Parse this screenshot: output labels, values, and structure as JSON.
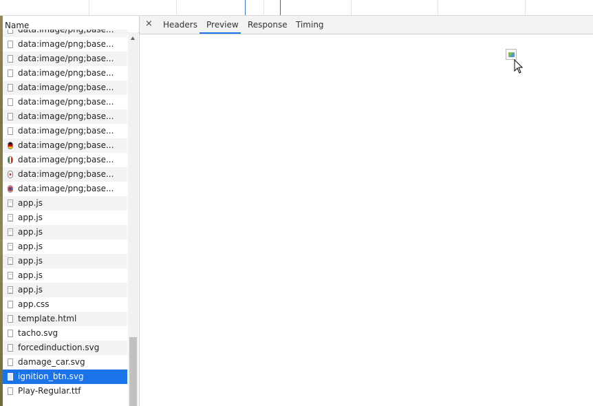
{
  "request_list": {
    "column_header": "Name",
    "rows": [
      {
        "name": "data:image/png;base...",
        "icon": "file-icon"
      },
      {
        "name": "data:image/png;base...",
        "icon": "file-icon"
      },
      {
        "name": "data:image/png;base...",
        "icon": "file-icon"
      },
      {
        "name": "data:image/png;base...",
        "icon": "file-icon"
      },
      {
        "name": "data:image/png;base...",
        "icon": "file-icon"
      },
      {
        "name": "data:image/png;base...",
        "icon": "file-icon"
      },
      {
        "name": "data:image/png;base...",
        "icon": "file-icon"
      },
      {
        "name": "data:image/png;base...",
        "icon": "file-icon"
      },
      {
        "name": "data:image/png;base...",
        "icon": "german-flag-icon"
      },
      {
        "name": "data:image/png;base...",
        "icon": "italian-flag-icon"
      },
      {
        "name": "data:image/png;base...",
        "icon": "japanese-flag-icon"
      },
      {
        "name": "data:image/png;base...",
        "icon": "us-flag-icon"
      },
      {
        "name": "app.js",
        "icon": "text-file-icon"
      },
      {
        "name": "app.js",
        "icon": "text-file-icon"
      },
      {
        "name": "app.js",
        "icon": "text-file-icon"
      },
      {
        "name": "app.js",
        "icon": "text-file-icon"
      },
      {
        "name": "app.js",
        "icon": "text-file-icon"
      },
      {
        "name": "app.js",
        "icon": "text-file-icon"
      },
      {
        "name": "app.js",
        "icon": "text-file-icon"
      },
      {
        "name": "app.css",
        "icon": "file-icon"
      },
      {
        "name": "template.html",
        "icon": "file-icon"
      },
      {
        "name": "tacho.svg",
        "icon": "file-icon"
      },
      {
        "name": "forcedinduction.svg",
        "icon": "file-icon"
      },
      {
        "name": "damage_car.svg",
        "icon": "file-icon"
      },
      {
        "name": "ignition_btn.svg",
        "icon": "image-file-icon",
        "selected": true
      },
      {
        "name": "Play-Regular.ttf",
        "icon": "file-icon"
      }
    ]
  },
  "details": {
    "close_label": "×",
    "tabs": [
      {
        "label": "Headers",
        "active": false
      },
      {
        "label": "Preview",
        "active": true
      },
      {
        "label": "Response",
        "active": false
      },
      {
        "label": "Timing",
        "active": false
      }
    ]
  },
  "colors": {
    "selection": "#1a73e8",
    "tab_underline": "#1a73e8"
  }
}
